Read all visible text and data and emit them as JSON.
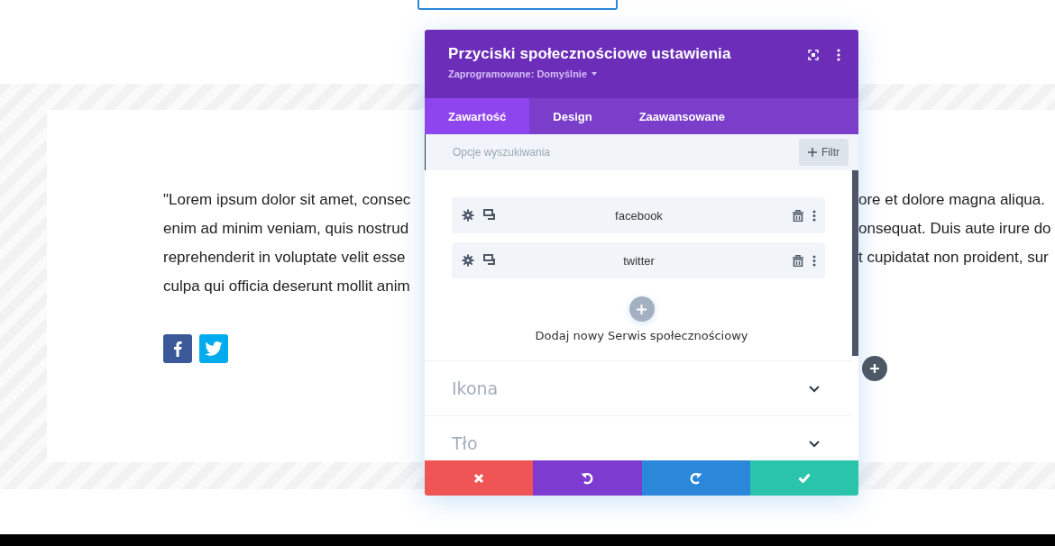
{
  "page": {
    "text_lines": [
      {
        "left": "\"Lorem ipsum dolor sit amet, consec",
        "right": "ore et dolore magna aliqua."
      },
      {
        "left": "enim ad minim veniam, quis nostrud",
        "right": "onsequat. Duis aute irure do"
      },
      {
        "left": "reprehenderit in voluptate velit esse",
        "right": "t cupidatat non proident, sur"
      },
      {
        "left": "culpa qui officia deserunt mollit anim"
      }
    ],
    "social_icons": [
      {
        "kind": "facebook"
      },
      {
        "kind": "twitter"
      }
    ]
  },
  "modal": {
    "title": "Przyciski społecznościowe ustawienia",
    "preset": "Zaprogramowane: Domyślnie",
    "tabs": [
      {
        "label": "Zawartość",
        "selected": true
      },
      {
        "label": "Design",
        "selected": false
      },
      {
        "label": "Zaawansowane",
        "selected": false
      }
    ],
    "search": {
      "placeholder": "Opcje wyszukiwania"
    },
    "filter_button": "Filtr",
    "items": [
      {
        "label": "facebook"
      },
      {
        "label": "twitter"
      }
    ],
    "add_label": "Dodaj nowy Serwis społecznościowy",
    "sections": [
      {
        "label": "Ikona",
        "expanded": false
      },
      {
        "label": "Tło",
        "expanded": false
      }
    ],
    "footer_buttons": [
      {
        "kind": "cancel"
      },
      {
        "kind": "undo"
      },
      {
        "kind": "redo"
      },
      {
        "kind": "save"
      }
    ]
  }
}
